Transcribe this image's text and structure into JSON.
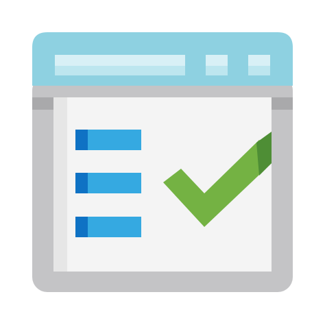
{
  "icon": {
    "name": "checklist-window-icon",
    "description_visible_text": "",
    "colors": {
      "title_bar": "#8ED1E1",
      "title_bar_highlight": "#D8F0F6",
      "title_bar_highlight_accent": "#BDE6EF",
      "window_frame": "#C4C4C6",
      "window_frame_dark": "#A9A9AB",
      "content_bg": "#F4F4F4",
      "content_left_strip": "#E6E6E6",
      "list_item_fill": "#35A9E1",
      "list_item_bullet": "#0F72C4",
      "check_light": "#74B243",
      "check_dark": "#4E8E35"
    },
    "list_items_count": 3
  }
}
